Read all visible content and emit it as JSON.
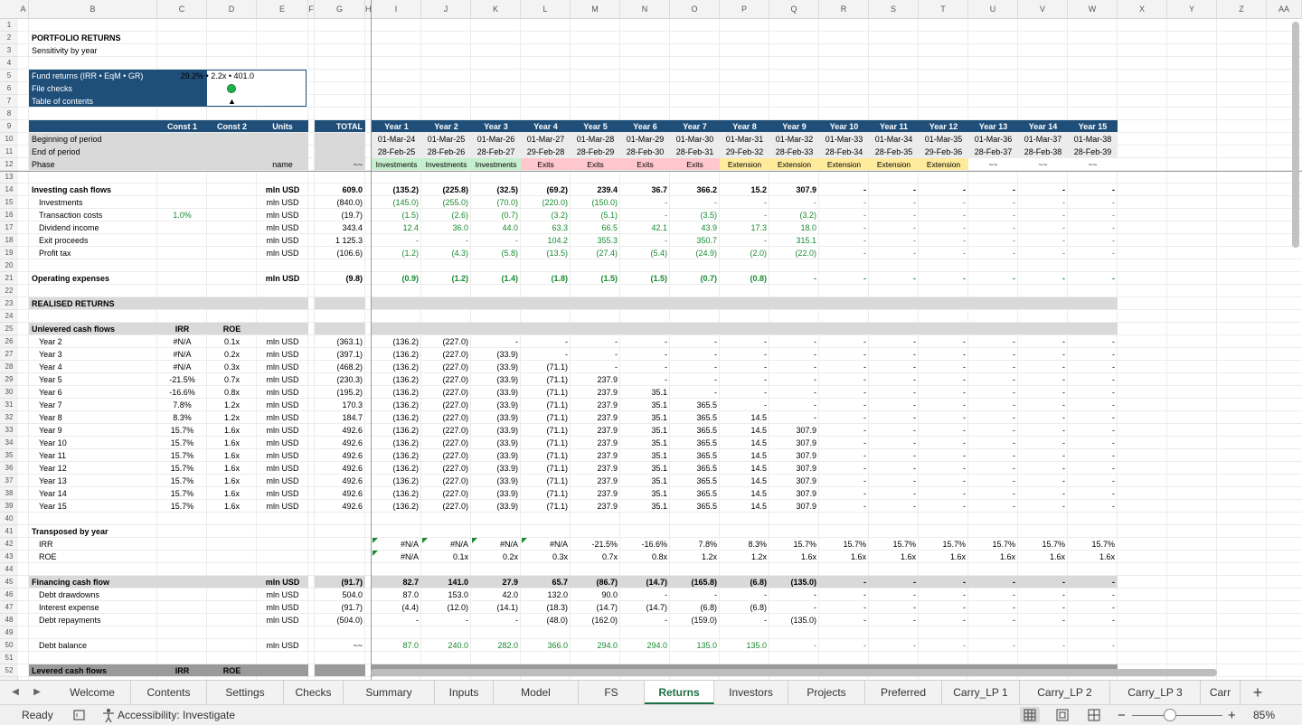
{
  "columns": [
    "A",
    "B",
    "C",
    "D",
    "E",
    "F",
    "G",
    "H",
    "I",
    "J",
    "K",
    "L",
    "M",
    "N",
    "O",
    "P",
    "Q",
    "R",
    "S",
    "T",
    "U",
    "V",
    "W",
    "X",
    "Y",
    "Z",
    "AA"
  ],
  "rows": [
    "1",
    "2",
    "3",
    "4",
    "5",
    "6",
    "7",
    "8",
    "9",
    "10",
    "11",
    "12",
    "13",
    "14",
    "15",
    "16",
    "17",
    "18",
    "19",
    "20",
    "21",
    "22",
    "23",
    "24",
    "25",
    "26",
    "27",
    "28",
    "29",
    "30",
    "31",
    "32",
    "33",
    "34",
    "35",
    "36",
    "37",
    "38",
    "39",
    "40",
    "41",
    "42",
    "43",
    "44",
    "45",
    "46",
    "47",
    "48",
    "49",
    "50",
    "51",
    "52"
  ],
  "title": "PORTFOLIO RETURNS",
  "subtitle": "Sensitivity by year",
  "summary_box": {
    "fund_returns_label": "Fund returns (IRR • EqM • GR)",
    "fund_returns_value": "29.2% • 2.2x • 401.0",
    "file_checks_label": "File checks",
    "toc_label": "Table of contents",
    "toc_glyph": "▲"
  },
  "header_labels": {
    "const1": "Const 1",
    "const2": "Const 2",
    "units": "Units",
    "total": "TOTAL"
  },
  "years": [
    "Year 1",
    "Year 2",
    "Year 3",
    "Year 4",
    "Year 5",
    "Year 6",
    "Year 7",
    "Year 8",
    "Year 9",
    "Year 10",
    "Year 11",
    "Year 12",
    "Year 13",
    "Year 14",
    "Year 15"
  ],
  "period": {
    "begin_label": "Beginning of period",
    "end_label": "End of period",
    "phase_label": "Phase",
    "phase_units": "name",
    "phase_total": "~~",
    "begin": [
      "01-Mar-24",
      "01-Mar-25",
      "01-Mar-26",
      "01-Mar-27",
      "01-Mar-28",
      "01-Mar-29",
      "01-Mar-30",
      "01-Mar-31",
      "01-Mar-32",
      "01-Mar-33",
      "01-Mar-34",
      "01-Mar-35",
      "01-Mar-36",
      "01-Mar-37",
      "01-Mar-38"
    ],
    "end": [
      "28-Feb-25",
      "28-Feb-26",
      "28-Feb-27",
      "29-Feb-28",
      "28-Feb-29",
      "28-Feb-30",
      "28-Feb-31",
      "29-Feb-32",
      "28-Feb-33",
      "28-Feb-34",
      "28-Feb-35",
      "29-Feb-36",
      "28-Feb-37",
      "28-Feb-38",
      "28-Feb-39"
    ],
    "phase": [
      "Investments",
      "Investments",
      "Investments",
      "Exits",
      "Exits",
      "Exits",
      "Exits",
      "Extension",
      "Extension",
      "Extension",
      "Extension",
      "Extension",
      "~~",
      "~~",
      "~~"
    ]
  },
  "phase_colors": {
    "Investments": "#c6efce",
    "Exits": "#ffc7ce",
    "Extension": "#ffeb9c",
    "~~": "#ffffff"
  },
  "colors": {
    "header_blue": "#1f4e79",
    "band_gray": "#d9d9d9",
    "green_text": "#178a2e",
    "active_tab": "#1e7145",
    "status_dot": "#21b14a"
  },
  "investing": {
    "label": "Investing cash flows",
    "units": "mln USD",
    "total": "609.0",
    "values": [
      "(135.2)",
      "(225.8)",
      "(32.5)",
      "(69.2)",
      "239.4",
      "36.7",
      "366.2",
      "15.2",
      "307.9",
      "-",
      "-",
      "-",
      "-",
      "-",
      "-"
    ],
    "items": [
      {
        "label": "Investments",
        "const1": "",
        "units": "mln USD",
        "total": "(840.0)",
        "values": [
          "(145.0)",
          "(255.0)",
          "(70.0)",
          "(220.0)",
          "(150.0)",
          "-",
          "-",
          "-",
          "-",
          "-",
          "-",
          "-",
          "-",
          "-",
          "-"
        ]
      },
      {
        "label": "Transaction costs",
        "const1": "1.0%",
        "units": "mln USD",
        "total": "(19.7)",
        "values": [
          "(1.5)",
          "(2.6)",
          "(0.7)",
          "(3.2)",
          "(5.1)",
          "-",
          "(3.5)",
          "-",
          "(3.2)",
          "-",
          "-",
          "-",
          "-",
          "-",
          "-"
        ]
      },
      {
        "label": "Dividend income",
        "const1": "",
        "units": "mln USD",
        "total": "343.4",
        "values": [
          "12.4",
          "36.0",
          "44.0",
          "63.3",
          "66.5",
          "42.1",
          "43.9",
          "17.3",
          "18.0",
          "-",
          "-",
          "-",
          "-",
          "-",
          "-"
        ]
      },
      {
        "label": "Exit proceeds",
        "const1": "",
        "units": "mln USD",
        "total": "1 125.3",
        "values": [
          "-",
          "-",
          "-",
          "104.2",
          "355.3",
          "-",
          "350.7",
          "-",
          "315.1",
          "-",
          "-",
          "-",
          "-",
          "-",
          "-"
        ]
      },
      {
        "label": "Profit tax",
        "const1": "",
        "units": "mln USD",
        "total": "(106.6)",
        "values": [
          "(1.2)",
          "(4.3)",
          "(5.8)",
          "(13.5)",
          "(27.4)",
          "(5.4)",
          "(24.9)",
          "(2.0)",
          "(22.0)",
          "-",
          "-",
          "-",
          "-",
          "-",
          "-"
        ]
      }
    ]
  },
  "opex": {
    "label": "Operating expenses",
    "units": "mln USD",
    "total": "(9.8)",
    "values": [
      "(0.9)",
      "(1.2)",
      "(1.4)",
      "(1.8)",
      "(1.5)",
      "(1.5)",
      "(0.7)",
      "(0.8)",
      "-",
      "-",
      "-",
      "-",
      "-",
      "-",
      "-"
    ]
  },
  "realised_label": "REALISED RETURNS",
  "unlevered": {
    "label": "Unlevered cash flows",
    "irr_label": "IRR",
    "roe_label": "ROE",
    "rows": [
      {
        "label": "Year 2",
        "irr": "#N/A",
        "roe": "0.1x",
        "units": "mln USD",
        "total": "(363.1)",
        "values": [
          "(136.2)",
          "(227.0)",
          "-",
          "-",
          "-",
          "-",
          "-",
          "-",
          "-",
          "-",
          "-",
          "-",
          "-",
          "-",
          "-"
        ]
      },
      {
        "label": "Year 3",
        "irr": "#N/A",
        "roe": "0.2x",
        "units": "mln USD",
        "total": "(397.1)",
        "values": [
          "(136.2)",
          "(227.0)",
          "(33.9)",
          "-",
          "-",
          "-",
          "-",
          "-",
          "-",
          "-",
          "-",
          "-",
          "-",
          "-",
          "-"
        ]
      },
      {
        "label": "Year 4",
        "irr": "#N/A",
        "roe": "0.3x",
        "units": "mln USD",
        "total": "(468.2)",
        "values": [
          "(136.2)",
          "(227.0)",
          "(33.9)",
          "(71.1)",
          "-",
          "-",
          "-",
          "-",
          "-",
          "-",
          "-",
          "-",
          "-",
          "-",
          "-"
        ]
      },
      {
        "label": "Year 5",
        "irr": "-21.5%",
        "roe": "0.7x",
        "units": "mln USD",
        "total": "(230.3)",
        "values": [
          "(136.2)",
          "(227.0)",
          "(33.9)",
          "(71.1)",
          "237.9",
          "-",
          "-",
          "-",
          "-",
          "-",
          "-",
          "-",
          "-",
          "-",
          "-"
        ]
      },
      {
        "label": "Year 6",
        "irr": "-16.6%",
        "roe": "0.8x",
        "units": "mln USD",
        "total": "(195.2)",
        "values": [
          "(136.2)",
          "(227.0)",
          "(33.9)",
          "(71.1)",
          "237.9",
          "35.1",
          "-",
          "-",
          "-",
          "-",
          "-",
          "-",
          "-",
          "-",
          "-"
        ]
      },
      {
        "label": "Year 7",
        "irr": "7.8%",
        "roe": "1.2x",
        "units": "mln USD",
        "total": "170.3",
        "values": [
          "(136.2)",
          "(227.0)",
          "(33.9)",
          "(71.1)",
          "237.9",
          "35.1",
          "365.5",
          "-",
          "-",
          "-",
          "-",
          "-",
          "-",
          "-",
          "-"
        ]
      },
      {
        "label": "Year 8",
        "irr": "8.3%",
        "roe": "1.2x",
        "units": "mln USD",
        "total": "184.7",
        "values": [
          "(136.2)",
          "(227.0)",
          "(33.9)",
          "(71.1)",
          "237.9",
          "35.1",
          "365.5",
          "14.5",
          "-",
          "-",
          "-",
          "-",
          "-",
          "-",
          "-"
        ]
      },
      {
        "label": "Year 9",
        "irr": "15.7%",
        "roe": "1.6x",
        "units": "mln USD",
        "total": "492.6",
        "values": [
          "(136.2)",
          "(227.0)",
          "(33.9)",
          "(71.1)",
          "237.9",
          "35.1",
          "365.5",
          "14.5",
          "307.9",
          "-",
          "-",
          "-",
          "-",
          "-",
          "-"
        ]
      },
      {
        "label": "Year 10",
        "irr": "15.7%",
        "roe": "1.6x",
        "units": "mln USD",
        "total": "492.6",
        "values": [
          "(136.2)",
          "(227.0)",
          "(33.9)",
          "(71.1)",
          "237.9",
          "35.1",
          "365.5",
          "14.5",
          "307.9",
          "-",
          "-",
          "-",
          "-",
          "-",
          "-"
        ]
      },
      {
        "label": "Year 11",
        "irr": "15.7%",
        "roe": "1.6x",
        "units": "mln USD",
        "total": "492.6",
        "values": [
          "(136.2)",
          "(227.0)",
          "(33.9)",
          "(71.1)",
          "237.9",
          "35.1",
          "365.5",
          "14.5",
          "307.9",
          "-",
          "-",
          "-",
          "-",
          "-",
          "-"
        ]
      },
      {
        "label": "Year 12",
        "irr": "15.7%",
        "roe": "1.6x",
        "units": "mln USD",
        "total": "492.6",
        "values": [
          "(136.2)",
          "(227.0)",
          "(33.9)",
          "(71.1)",
          "237.9",
          "35.1",
          "365.5",
          "14.5",
          "307.9",
          "-",
          "-",
          "-",
          "-",
          "-",
          "-"
        ]
      },
      {
        "label": "Year 13",
        "irr": "15.7%",
        "roe": "1.6x",
        "units": "mln USD",
        "total": "492.6",
        "values": [
          "(136.2)",
          "(227.0)",
          "(33.9)",
          "(71.1)",
          "237.9",
          "35.1",
          "365.5",
          "14.5",
          "307.9",
          "-",
          "-",
          "-",
          "-",
          "-",
          "-"
        ]
      },
      {
        "label": "Year 14",
        "irr": "15.7%",
        "roe": "1.6x",
        "units": "mln USD",
        "total": "492.6",
        "values": [
          "(136.2)",
          "(227.0)",
          "(33.9)",
          "(71.1)",
          "237.9",
          "35.1",
          "365.5",
          "14.5",
          "307.9",
          "-",
          "-",
          "-",
          "-",
          "-",
          "-"
        ]
      },
      {
        "label": "Year 15",
        "irr": "15.7%",
        "roe": "1.6x",
        "units": "mln USD",
        "total": "492.6",
        "values": [
          "(136.2)",
          "(227.0)",
          "(33.9)",
          "(71.1)",
          "237.9",
          "35.1",
          "365.5",
          "14.5",
          "307.9",
          "-",
          "-",
          "-",
          "-",
          "-",
          "-"
        ]
      }
    ]
  },
  "transposed": {
    "label": "Transposed by year",
    "irr_label": "IRR",
    "roe_label": "ROE",
    "irr": [
      "#N/A",
      "#N/A",
      "#N/A",
      "#N/A",
      "-21.5%",
      "-16.6%",
      "7.8%",
      "8.3%",
      "15.7%",
      "15.7%",
      "15.7%",
      "15.7%",
      "15.7%",
      "15.7%",
      "15.7%"
    ],
    "roe": [
      "#N/A",
      "0.1x",
      "0.2x",
      "0.3x",
      "0.7x",
      "0.8x",
      "1.2x",
      "1.2x",
      "1.6x",
      "1.6x",
      "1.6x",
      "1.6x",
      "1.6x",
      "1.6x",
      "1.6x"
    ]
  },
  "financing": {
    "label": "Financing cash flow",
    "units": "mln USD",
    "total": "(91.7)",
    "values": [
      "82.7",
      "141.0",
      "27.9",
      "65.7",
      "(86.7)",
      "(14.7)",
      "(165.8)",
      "(6.8)",
      "(135.0)",
      "-",
      "-",
      "-",
      "-",
      "-",
      "-"
    ],
    "items": [
      {
        "label": "Debt drawdowns",
        "units": "mln USD",
        "total": "504.0",
        "values": [
          "87.0",
          "153.0",
          "42.0",
          "132.0",
          "90.0",
          "-",
          "-",
          "-",
          "-",
          "-",
          "-",
          "-",
          "-",
          "-",
          "-"
        ]
      },
      {
        "label": "Interest expense",
        "units": "mln USD",
        "total": "(91.7)",
        "values": [
          "(4.4)",
          "(12.0)",
          "(14.1)",
          "(18.3)",
          "(14.7)",
          "(14.7)",
          "(6.8)",
          "(6.8)",
          "-",
          "-",
          "-",
          "-",
          "-",
          "-",
          "-"
        ]
      },
      {
        "label": "Debt repayments",
        "units": "mln USD",
        "total": "(504.0)",
        "values": [
          "-",
          "-",
          "-",
          "(48.0)",
          "(162.0)",
          "-",
          "(159.0)",
          "-",
          "(135.0)",
          "-",
          "-",
          "-",
          "-",
          "-",
          "-"
        ]
      }
    ]
  },
  "debt_balance": {
    "label": "Debt balance",
    "units": "mln USD",
    "total": "~~",
    "values": [
      "87.0",
      "240.0",
      "282.0",
      "366.0",
      "294.0",
      "294.0",
      "135.0",
      "135.0",
      "-",
      "-",
      "-",
      "-",
      "-",
      "-",
      "-"
    ]
  },
  "levered": {
    "label": "Levered cash flows",
    "irr_label": "IRR",
    "roe_label": "ROE"
  },
  "tabs": [
    "Welcome",
    "Contents",
    "Settings",
    "Checks",
    "Summary",
    "Inputs",
    "Model",
    "FS",
    "Returns",
    "Investors",
    "Projects",
    "Preferred",
    "Carry_LP 1",
    "Carry_LP 2",
    "Carry_LP 3",
    "Carr"
  ],
  "active_tab": "Returns",
  "status": {
    "ready": "Ready",
    "accessibility": "Accessibility: Investigate",
    "zoom": "85%"
  },
  "icons": [
    "tab-prev-icon",
    "tab-next-icon",
    "add-sheet-icon",
    "macro-record-icon",
    "accessibility-icon",
    "normal-view-icon",
    "page-layout-icon",
    "page-break-icon",
    "zoom-out-icon",
    "zoom-in-icon"
  ]
}
